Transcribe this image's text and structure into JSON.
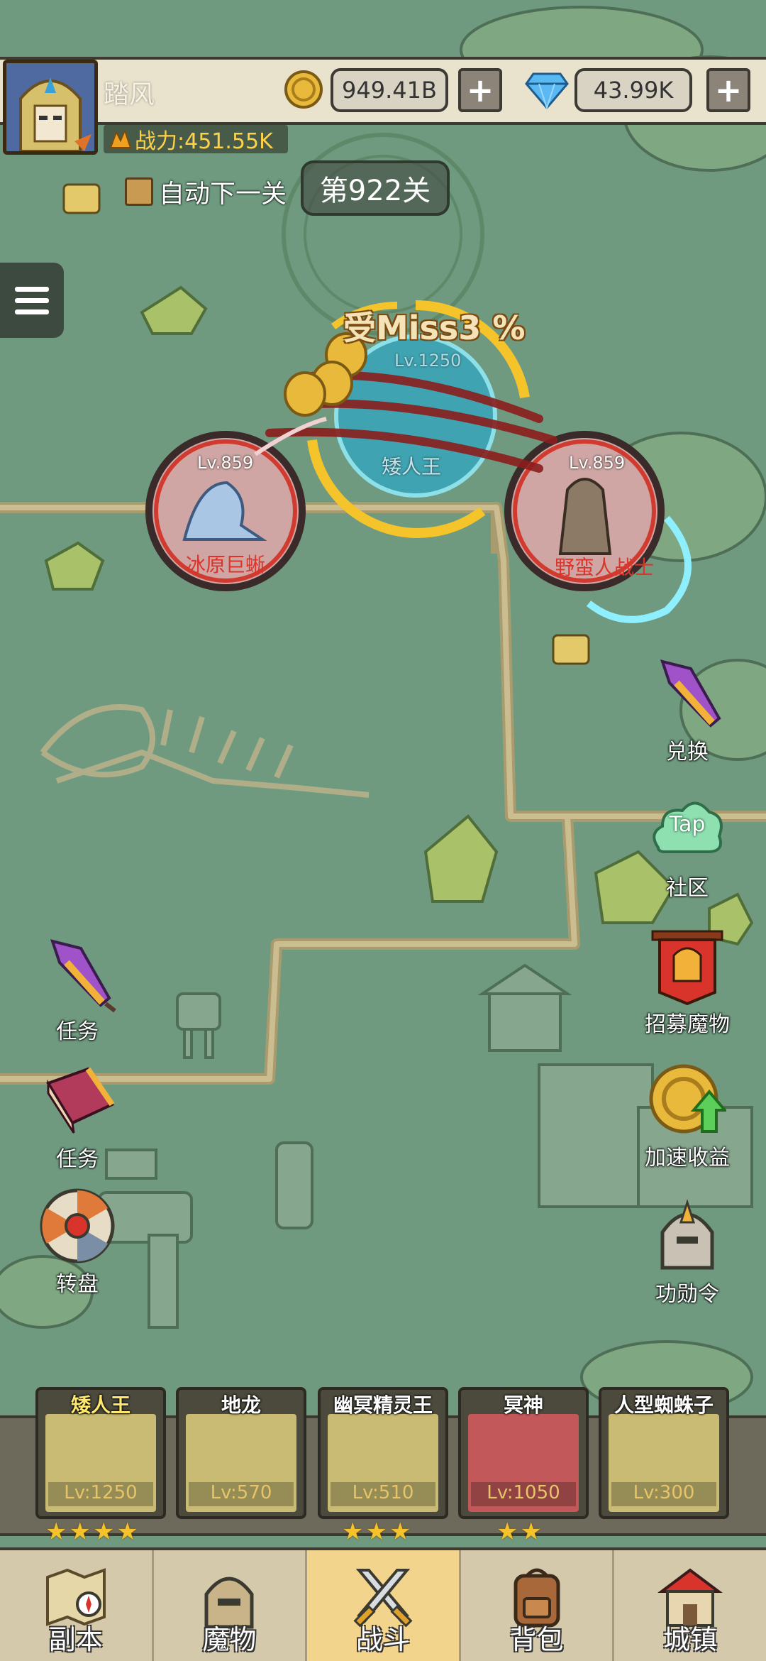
{
  "player": {
    "name": "踏风",
    "power": "战力:451.55K",
    "gold": "949.41B",
    "diamonds": "43.99K",
    "add_symbol": "+"
  },
  "stage": {
    "auto_next_label": "自动下一关",
    "stage_label": "第922关"
  },
  "battle": {
    "miss_text": "受Miss3 %",
    "boss": {
      "level": "Lv.1250",
      "name": "矮人王"
    },
    "enemy_left": {
      "level": "Lv.859",
      "name": "冰原巨蜥"
    },
    "enemy_right": {
      "level": "Lv.859",
      "name": "野蛮人战士"
    }
  },
  "side_left": [
    {
      "label": "任务",
      "icon": "rocket-icon"
    },
    {
      "label": "任务",
      "icon": "book-icon"
    },
    {
      "label": "转盘",
      "icon": "wheel-icon"
    }
  ],
  "side_right": [
    {
      "label": "兑换",
      "icon": "rocket-icon"
    },
    {
      "label": "社区",
      "icon": "tap-cloud-icon",
      "badge": "Tap"
    },
    {
      "label": "招募魔物",
      "icon": "recruit-banner-icon"
    },
    {
      "label": "加速收益",
      "icon": "speed-coin-icon"
    },
    {
      "label": "功勋令",
      "icon": "helmet-icon"
    }
  ],
  "heroes": [
    {
      "name": "矮人王",
      "level": "Lv:1250",
      "stars": 4
    },
    {
      "name": "地龙",
      "level": "Lv:570",
      "stars": 0
    },
    {
      "name": "幽冥精灵王",
      "level": "Lv:510",
      "stars": 3
    },
    {
      "name": "冥神",
      "level": "Lv:1050",
      "stars": 2
    },
    {
      "name": "人型蜘蛛子",
      "level": "Lv:300",
      "stars": 0
    }
  ],
  "nav": [
    {
      "label": "副本",
      "icon": "map-icon",
      "active": false
    },
    {
      "label": "魔物",
      "icon": "monster-helmet-icon",
      "active": false
    },
    {
      "label": "战斗",
      "icon": "crossed-swords-icon",
      "active": true
    },
    {
      "label": "背包",
      "icon": "backpack-icon",
      "active": false
    },
    {
      "label": "城镇",
      "icon": "town-icon",
      "active": false
    }
  ],
  "colors": {
    "map_bg": "#6f9a7f",
    "path": "#c8b98a",
    "gold": "#ffd24a",
    "enemy_name": "#d9352b",
    "active_tab": "#f3d48c"
  }
}
